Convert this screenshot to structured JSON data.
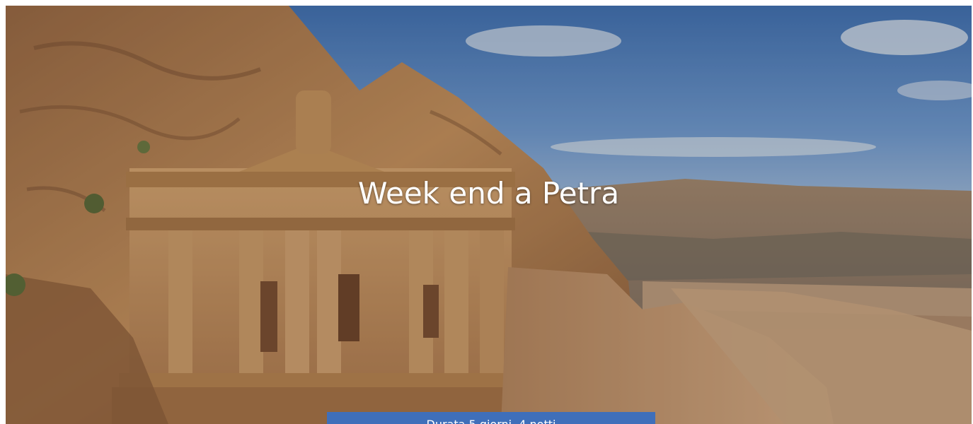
{
  "hero": {
    "title": "Week end a Petra",
    "duration": "Durata 5 giorni, 4 notti"
  },
  "colors": {
    "badge_background": "#3f6fba",
    "title_text": "#ffffff",
    "sky": "#5d8fcf",
    "rock": "#c79a6a"
  }
}
